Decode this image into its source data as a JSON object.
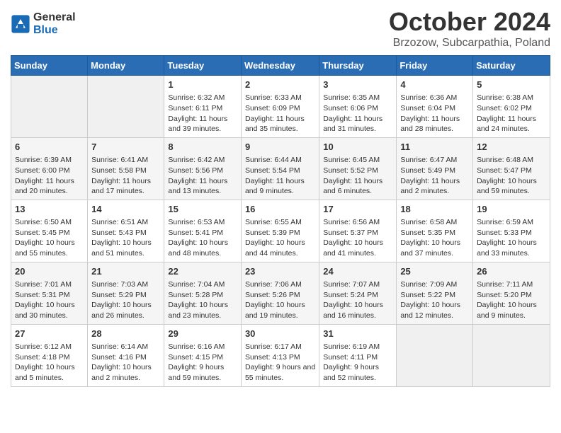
{
  "header": {
    "logo_general": "General",
    "logo_blue": "Blue",
    "month": "October 2024",
    "location": "Brzozow, Subcarpathia, Poland"
  },
  "days_of_week": [
    "Sunday",
    "Monday",
    "Tuesday",
    "Wednesday",
    "Thursday",
    "Friday",
    "Saturday"
  ],
  "weeks": [
    [
      {
        "day": "",
        "info": ""
      },
      {
        "day": "",
        "info": ""
      },
      {
        "day": "1",
        "info": "Sunrise: 6:32 AM\nSunset: 6:11 PM\nDaylight: 11 hours and 39 minutes."
      },
      {
        "day": "2",
        "info": "Sunrise: 6:33 AM\nSunset: 6:09 PM\nDaylight: 11 hours and 35 minutes."
      },
      {
        "day": "3",
        "info": "Sunrise: 6:35 AM\nSunset: 6:06 PM\nDaylight: 11 hours and 31 minutes."
      },
      {
        "day": "4",
        "info": "Sunrise: 6:36 AM\nSunset: 6:04 PM\nDaylight: 11 hours and 28 minutes."
      },
      {
        "day": "5",
        "info": "Sunrise: 6:38 AM\nSunset: 6:02 PM\nDaylight: 11 hours and 24 minutes."
      }
    ],
    [
      {
        "day": "6",
        "info": "Sunrise: 6:39 AM\nSunset: 6:00 PM\nDaylight: 11 hours and 20 minutes."
      },
      {
        "day": "7",
        "info": "Sunrise: 6:41 AM\nSunset: 5:58 PM\nDaylight: 11 hours and 17 minutes."
      },
      {
        "day": "8",
        "info": "Sunrise: 6:42 AM\nSunset: 5:56 PM\nDaylight: 11 hours and 13 minutes."
      },
      {
        "day": "9",
        "info": "Sunrise: 6:44 AM\nSunset: 5:54 PM\nDaylight: 11 hours and 9 minutes."
      },
      {
        "day": "10",
        "info": "Sunrise: 6:45 AM\nSunset: 5:52 PM\nDaylight: 11 hours and 6 minutes."
      },
      {
        "day": "11",
        "info": "Sunrise: 6:47 AM\nSunset: 5:49 PM\nDaylight: 11 hours and 2 minutes."
      },
      {
        "day": "12",
        "info": "Sunrise: 6:48 AM\nSunset: 5:47 PM\nDaylight: 10 hours and 59 minutes."
      }
    ],
    [
      {
        "day": "13",
        "info": "Sunrise: 6:50 AM\nSunset: 5:45 PM\nDaylight: 10 hours and 55 minutes."
      },
      {
        "day": "14",
        "info": "Sunrise: 6:51 AM\nSunset: 5:43 PM\nDaylight: 10 hours and 51 minutes."
      },
      {
        "day": "15",
        "info": "Sunrise: 6:53 AM\nSunset: 5:41 PM\nDaylight: 10 hours and 48 minutes."
      },
      {
        "day": "16",
        "info": "Sunrise: 6:55 AM\nSunset: 5:39 PM\nDaylight: 10 hours and 44 minutes."
      },
      {
        "day": "17",
        "info": "Sunrise: 6:56 AM\nSunset: 5:37 PM\nDaylight: 10 hours and 41 minutes."
      },
      {
        "day": "18",
        "info": "Sunrise: 6:58 AM\nSunset: 5:35 PM\nDaylight: 10 hours and 37 minutes."
      },
      {
        "day": "19",
        "info": "Sunrise: 6:59 AM\nSunset: 5:33 PM\nDaylight: 10 hours and 33 minutes."
      }
    ],
    [
      {
        "day": "20",
        "info": "Sunrise: 7:01 AM\nSunset: 5:31 PM\nDaylight: 10 hours and 30 minutes."
      },
      {
        "day": "21",
        "info": "Sunrise: 7:03 AM\nSunset: 5:29 PM\nDaylight: 10 hours and 26 minutes."
      },
      {
        "day": "22",
        "info": "Sunrise: 7:04 AM\nSunset: 5:28 PM\nDaylight: 10 hours and 23 minutes."
      },
      {
        "day": "23",
        "info": "Sunrise: 7:06 AM\nSunset: 5:26 PM\nDaylight: 10 hours and 19 minutes."
      },
      {
        "day": "24",
        "info": "Sunrise: 7:07 AM\nSunset: 5:24 PM\nDaylight: 10 hours and 16 minutes."
      },
      {
        "day": "25",
        "info": "Sunrise: 7:09 AM\nSunset: 5:22 PM\nDaylight: 10 hours and 12 minutes."
      },
      {
        "day": "26",
        "info": "Sunrise: 7:11 AM\nSunset: 5:20 PM\nDaylight: 10 hours and 9 minutes."
      }
    ],
    [
      {
        "day": "27",
        "info": "Sunrise: 6:12 AM\nSunset: 4:18 PM\nDaylight: 10 hours and 5 minutes."
      },
      {
        "day": "28",
        "info": "Sunrise: 6:14 AM\nSunset: 4:16 PM\nDaylight: 10 hours and 2 minutes."
      },
      {
        "day": "29",
        "info": "Sunrise: 6:16 AM\nSunset: 4:15 PM\nDaylight: 9 hours and 59 minutes."
      },
      {
        "day": "30",
        "info": "Sunrise: 6:17 AM\nSunset: 4:13 PM\nDaylight: 9 hours and 55 minutes."
      },
      {
        "day": "31",
        "info": "Sunrise: 6:19 AM\nSunset: 4:11 PM\nDaylight: 9 hours and 52 minutes."
      },
      {
        "day": "",
        "info": ""
      },
      {
        "day": "",
        "info": ""
      }
    ]
  ]
}
